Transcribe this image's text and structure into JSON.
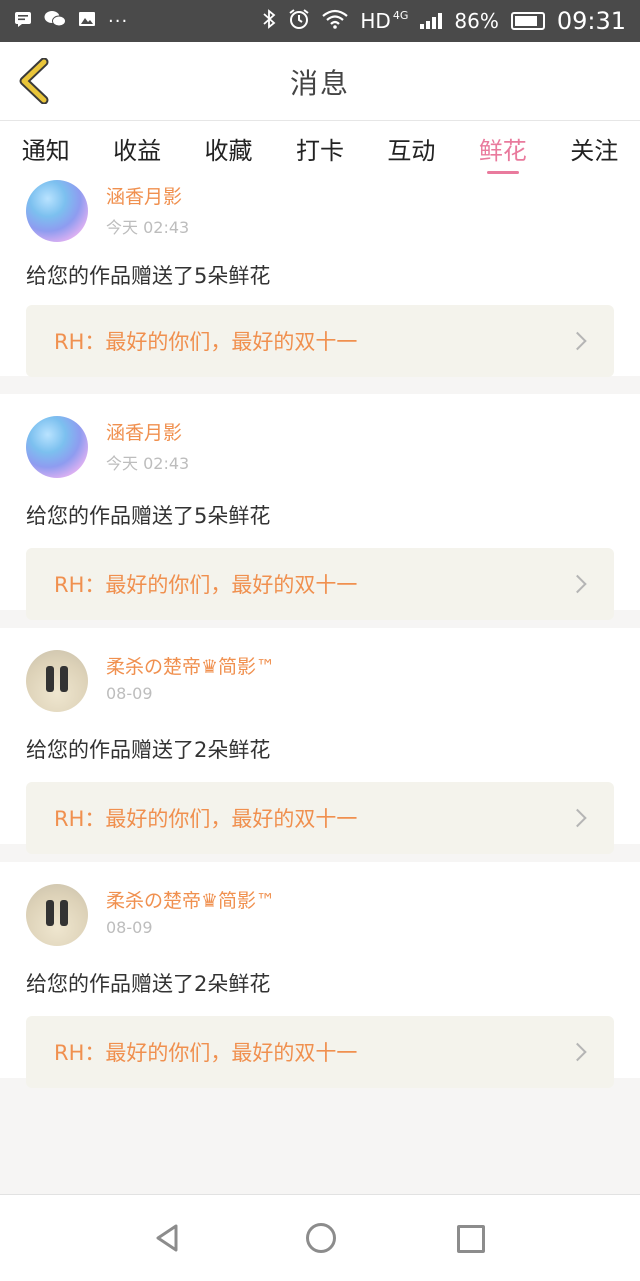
{
  "status_bar": {
    "network_label": "HD",
    "network_type": "4G",
    "battery_percent": "86%",
    "time": "09:31",
    "more_glyph": "···",
    "icons": [
      "message-icon",
      "wechat-icon",
      "image-icon",
      "bluetooth-icon",
      "alarm-icon",
      "wifi-icon",
      "signal-icon",
      "battery-icon"
    ]
  },
  "header": {
    "title": "消息",
    "back_icon": "chevron-left-icon",
    "accent_color": "#e9c53a"
  },
  "tabs": [
    {
      "label": "通知",
      "active": false
    },
    {
      "label": "收益",
      "active": false
    },
    {
      "label": "收藏",
      "active": false
    },
    {
      "label": "打卡",
      "active": false
    },
    {
      "label": "互动",
      "active": false
    },
    {
      "label": "鲜花",
      "active": true
    },
    {
      "label": "关注",
      "active": false
    }
  ],
  "colors": {
    "active_tab": "#e97a9d",
    "username": "#f0904f",
    "quote_text": "#f0904f",
    "quote_bg": "#f4f3ec"
  },
  "feed": [
    {
      "username": "涵香月影",
      "time": "今天 02:43",
      "message": "给您的作品赠送了5朵鲜花",
      "quote": "RH：最好的你们，最好的双十一",
      "avatar": "blue-sparkle-avatar"
    },
    {
      "username": "涵香月影",
      "time": "今天 02:43",
      "message": "给您的作品赠送了5朵鲜花",
      "quote": "RH：最好的你们，最好的双十一",
      "avatar": "blue-sparkle-avatar"
    },
    {
      "username": "柔杀の楚帝♛简影™",
      "time": "08-09",
      "message": "给您的作品赠送了2朵鲜花",
      "quote": "RH：最好的你们，最好的双十一",
      "avatar": "beach-jump-avatar"
    },
    {
      "username": "柔杀の楚帝♛简影™",
      "time": "08-09",
      "message": "给您的作品赠送了2朵鲜花",
      "quote": "RH：最好的你们，最好的双十一",
      "avatar": "beach-jump-avatar"
    }
  ],
  "nav_bar": {
    "buttons": [
      "back-triangle-icon",
      "home-circle-icon",
      "recent-square-icon"
    ]
  }
}
